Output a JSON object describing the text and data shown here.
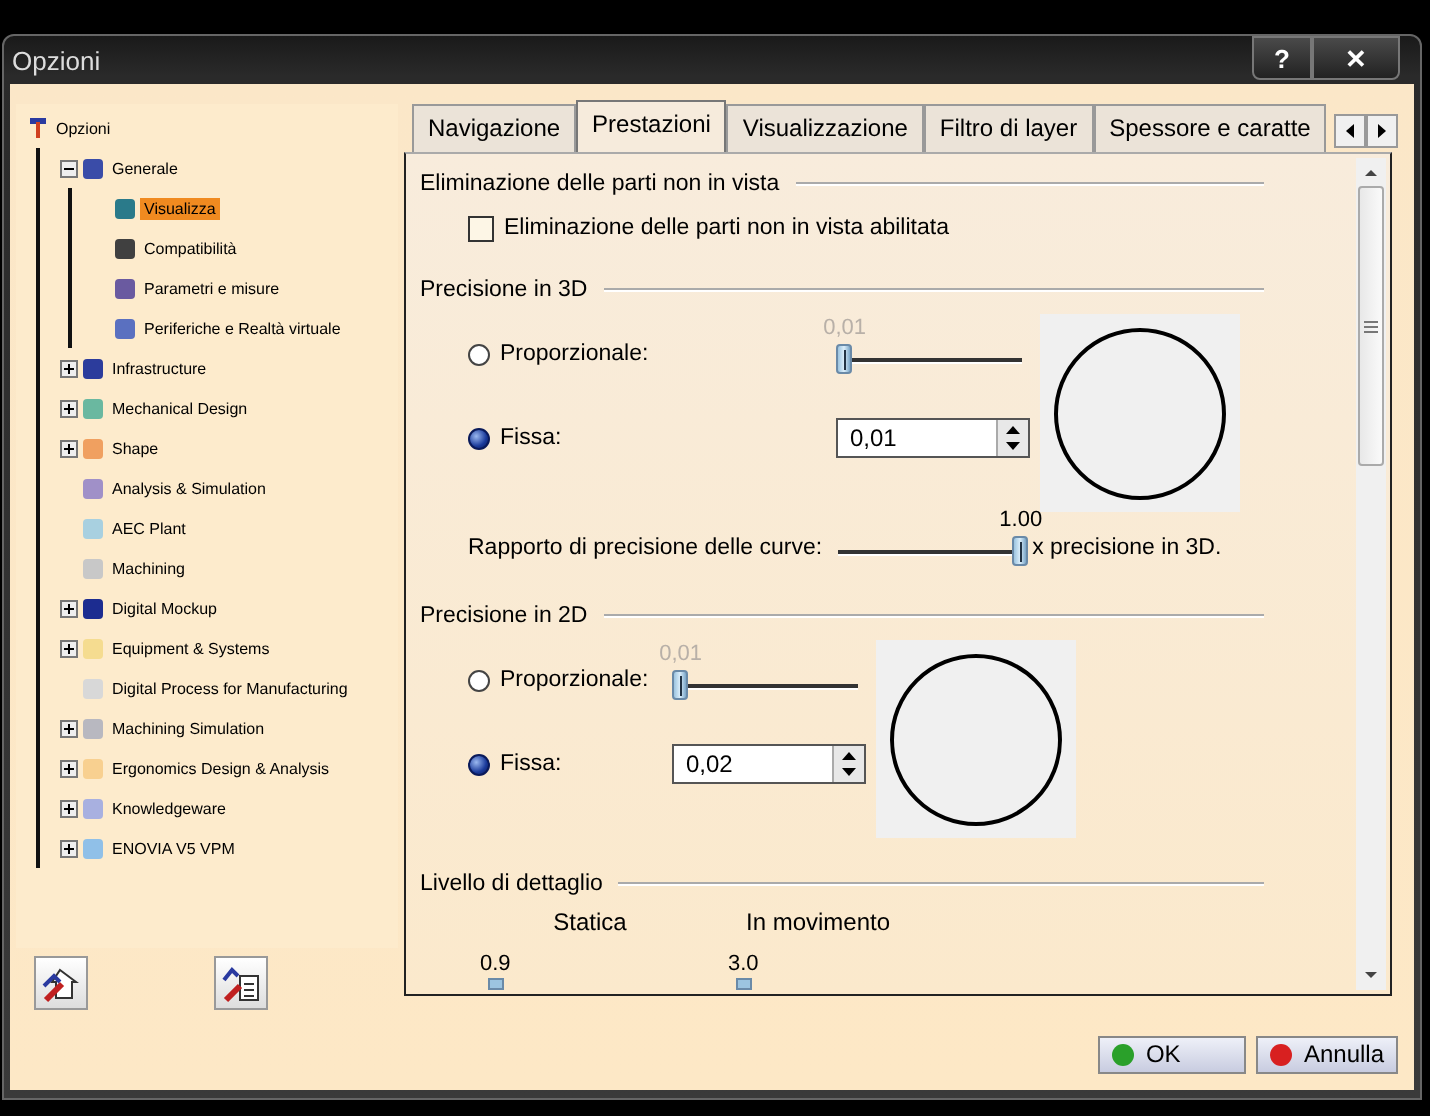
{
  "window": {
    "title": "Opzioni",
    "help_button": "?",
    "close_button": "✕"
  },
  "tree": {
    "label": "Opzioni",
    "expanded": true,
    "children": [
      {
        "label": "Generale",
        "color": "#3a4ca8",
        "expanded": true,
        "children": [
          {
            "label": "Visualizza",
            "color": "#2a7a8a",
            "selected": true
          },
          {
            "label": "Compatibilità",
            "color": "#404040",
            "selected": false
          },
          {
            "label": "Parametri e misure",
            "color": "#6a5aa0",
            "selected": false
          },
          {
            "label": "Periferiche e Realtà virtuale",
            "color": "#5a70c0",
            "selected": false
          }
        ]
      },
      {
        "label": "Infrastructure",
        "color": "#2c3c9c",
        "expanded": false
      },
      {
        "label": "Mechanical Design",
        "color": "#6ab8a0",
        "expanded": false
      },
      {
        "label": "Shape",
        "color": "#f0a060",
        "expanded": false
      },
      {
        "label": "Analysis & Simulation",
        "color": "#a090c8"
      },
      {
        "label": "AEC Plant",
        "color": "#a8d0e0"
      },
      {
        "label": "Machining",
        "color": "#c8c8c8"
      },
      {
        "label": "Digital Mockup",
        "color": "#1c2c90",
        "expanded": false
      },
      {
        "label": "Equipment & Systems",
        "color": "#f5dc90",
        "expanded": false
      },
      {
        "label": "Digital Process for Manufacturing",
        "color": "#d8d8d8"
      },
      {
        "label": "Machining Simulation",
        "color": "#b8b8c0",
        "expanded": false
      },
      {
        "label": "Ergonomics Design & Analysis",
        "color": "#f8d090",
        "expanded": false
      },
      {
        "label": "Knowledgeware",
        "color": "#a8b0e0",
        "expanded": false
      },
      {
        "label": "ENOVIA V5 VPM",
        "color": "#90c0e8",
        "expanded": false
      }
    ]
  },
  "tabs": [
    {
      "label": "Navigazione",
      "selected": false
    },
    {
      "label": "Prestazioni",
      "selected": true
    },
    {
      "label": "Visualizzazione",
      "selected": false
    },
    {
      "label": "Filtro di layer",
      "selected": false
    },
    {
      "label": "Spessore e caratte",
      "selected": false
    }
  ],
  "sections": [
    {
      "kind": "checkbox",
      "title": "Eliminazione delle parti non in vista",
      "checkbox": {
        "label": "Eliminazione delle parti non in vista abilitata",
        "checked": false
      }
    },
    {
      "kind": "precision",
      "title": "Precisione in 3D",
      "proportional": {
        "label": "Proporzionale:",
        "selected": false,
        "reading": "0,01",
        "level": 0,
        "disabled": true
      },
      "fixed": {
        "label": "Fissa:",
        "selected": true,
        "value": "0,01"
      },
      "ratio": {
        "label": "Rapporto di precisione delle curve:",
        "reading": "1.00",
        "level": 1,
        "suffix": "x precisione in 3D."
      }
    },
    {
      "kind": "precision",
      "title": "Precisione in 2D",
      "proportional": {
        "label": "Proporzionale:",
        "selected": false,
        "reading": "0,01",
        "level": 0,
        "disabled": true
      },
      "fixed": {
        "label": "Fissa:",
        "selected": true,
        "value": "0,02"
      }
    },
    {
      "kind": "detail",
      "title": "Livello di dettaglio",
      "columns": [
        {
          "label": "Statica",
          "reading": "0.9"
        },
        {
          "label": "In movimento",
          "reading": "3.0"
        }
      ]
    }
  ],
  "buttons": [
    {
      "label": "OK",
      "color": "#2aa02a"
    },
    {
      "label": "Annulla",
      "color": "#d82020"
    }
  ]
}
